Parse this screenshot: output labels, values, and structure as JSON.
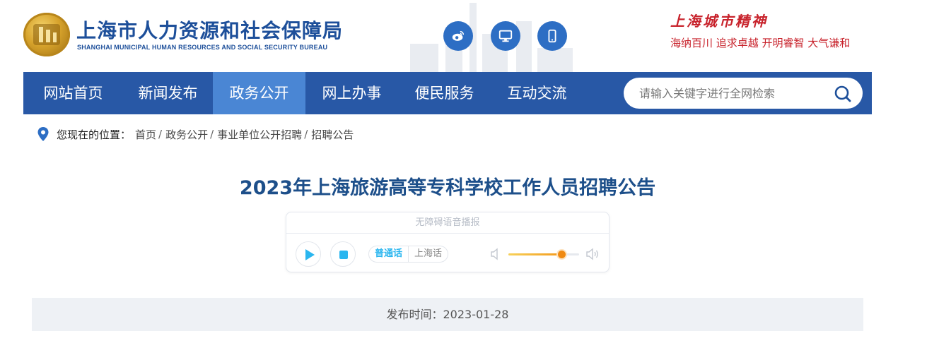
{
  "header": {
    "site_title": "上海市人力资源和社会保障局",
    "site_subtitle": "SHANGHAI MUNICIPAL HUMAN RESOURCES AND SOCIAL SECURITY BUREAU",
    "spirit_title": "上海城市精神",
    "spirit_text": "海纳百川  追求卓越  开明睿智  大气谦和",
    "icons": [
      "weibo-icon",
      "desktop-icon",
      "mobile-icon"
    ]
  },
  "nav": {
    "items": [
      {
        "label": "网站首页"
      },
      {
        "label": "新闻发布"
      },
      {
        "label": "政务公开"
      },
      {
        "label": "网上办事"
      },
      {
        "label": "便民服务"
      },
      {
        "label": "互动交流"
      }
    ],
    "active_index": 2,
    "search_placeholder": "请输入关键字进行全网检索"
  },
  "breadcrumb": {
    "label": "您现在的位置：",
    "items": [
      "首页",
      "政务公开",
      "事业单位公开招聘",
      "招聘公告"
    ],
    "separator": "/"
  },
  "article": {
    "title": "2023年上海旅游高等专科学校工作人员招聘公告",
    "publish_text": "发布时间：2023-01-28"
  },
  "player": {
    "header": "无障碍语音播报",
    "lang_options": [
      "普通话",
      "上海话"
    ],
    "selected_lang": "普通话",
    "volume_fraction": 0.75
  },
  "colors": {
    "brand_blue": "#2858a6",
    "nav_active": "#4a86d4",
    "title_blue": "#1d4f8a",
    "spirit_red": "#c8232c",
    "accent_cyan": "#2bb6ef"
  }
}
